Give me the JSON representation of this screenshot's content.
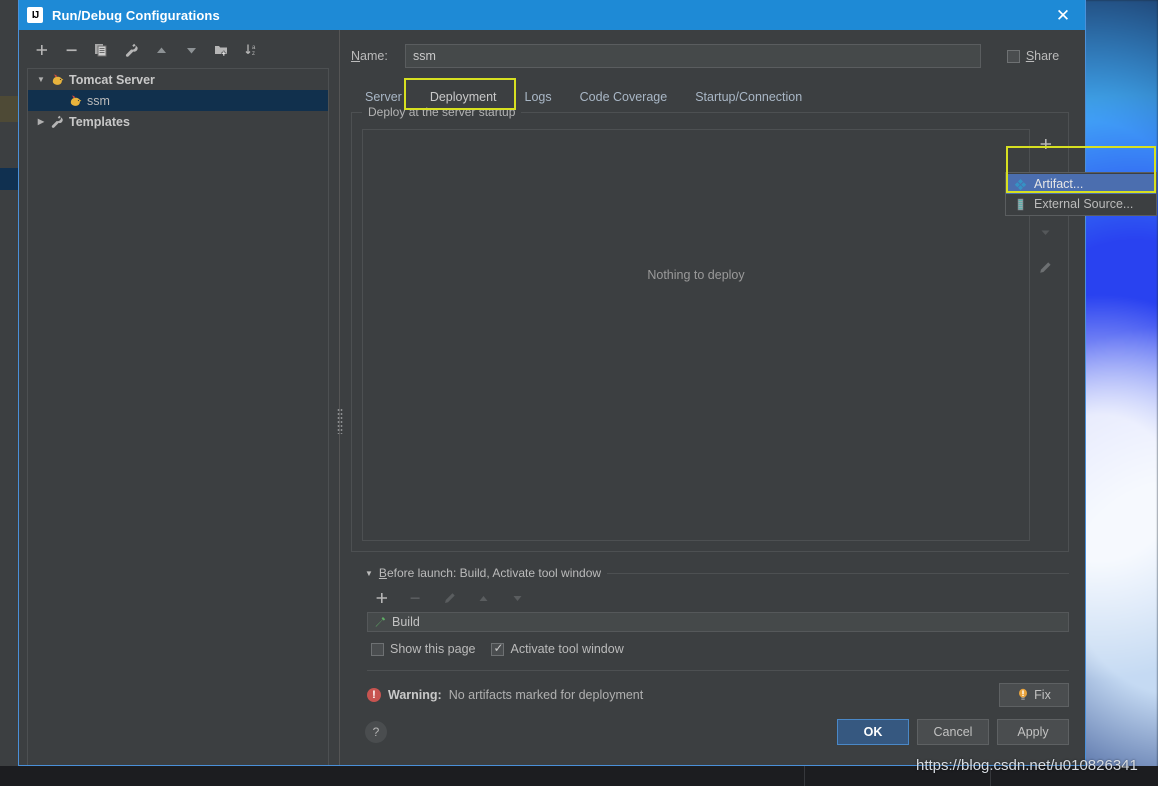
{
  "window": {
    "title": "Run/Debug Configurations",
    "logo_text": "IJ",
    "close_label": "✕"
  },
  "left_toolbar": [
    {
      "name": "add-icon",
      "label": "+"
    },
    {
      "name": "remove-icon",
      "label": "−"
    },
    {
      "name": "copy-icon",
      "label": "Copy"
    },
    {
      "name": "wrench-icon",
      "label": "Edit defaults"
    },
    {
      "name": "move-up-icon",
      "label": "Move Up"
    },
    {
      "name": "move-down-icon",
      "label": "Move Down"
    },
    {
      "name": "new-folder-icon",
      "label": "New Folder"
    },
    {
      "name": "sort-alphabetically-icon",
      "label": "Sort"
    }
  ],
  "tree": {
    "items": [
      {
        "label": "Tomcat Server",
        "icon": "tomcat-icon",
        "expanded": true,
        "selected": false,
        "level": 0,
        "arrow": "▼"
      },
      {
        "label": "ssm",
        "icon": "tomcat-icon",
        "expanded": false,
        "selected": true,
        "level": 1,
        "arrow": ""
      },
      {
        "label": "Templates",
        "icon": "wrench-icon",
        "expanded": false,
        "selected": false,
        "level": 0,
        "arrow": "▶"
      }
    ]
  },
  "name_field": {
    "label": "Name:",
    "label_mnemonic": "N",
    "label_rest": "ame:",
    "value": "ssm",
    "placeholder": ""
  },
  "share": {
    "label": "Share",
    "label_mnemonic": "S",
    "label_rest": "hare",
    "checked": false
  },
  "tabs": [
    {
      "label": "Server",
      "active": false
    },
    {
      "label": "Deployment",
      "active": true
    },
    {
      "label": "Logs",
      "active": false
    },
    {
      "label": "Code Coverage",
      "active": false
    },
    {
      "label": "Startup/Connection",
      "active": false
    }
  ],
  "deployment": {
    "group_title": "Deploy at the server startup",
    "empty_text": "Nothing to deploy",
    "vertical_toolbar": [
      {
        "name": "add-artifact-icon",
        "label": "+"
      },
      {
        "name": "move-down-icon",
        "label": "▼"
      },
      {
        "name": "edit-pencil-icon",
        "label": "Edit"
      }
    ]
  },
  "popup_menu": {
    "items": [
      {
        "label": "Artifact...",
        "icon": "artifact-diamond-icon",
        "selected": true
      },
      {
        "label": "External Source...",
        "icon": "external-source-icon",
        "selected": false
      }
    ]
  },
  "before_launch": {
    "header": "Before launch: Build, Activate tool window",
    "header_mnemonic": "B",
    "header_rest": "efore launch: Build, Activate tool window",
    "collapse_arrow": "▼",
    "toolbar": [
      {
        "name": "add-icon",
        "label": "+",
        "enabled": true
      },
      {
        "name": "remove-icon",
        "label": "−",
        "enabled": false
      },
      {
        "name": "edit-pencil-icon",
        "label": "Edit",
        "enabled": false
      },
      {
        "name": "move-up-icon",
        "label": "▲",
        "enabled": false
      },
      {
        "name": "move-down-icon",
        "label": "▼",
        "enabled": false
      }
    ],
    "task": {
      "label": "Build",
      "icon": "build-hammer-icon"
    },
    "show_this_page": {
      "label": "Show this page",
      "checked": false
    },
    "activate_tool_window": {
      "label": "Activate tool window",
      "checked": true
    }
  },
  "warning": {
    "prefix": "Warning:",
    "message": "No artifacts marked for deployment",
    "fix_label": "Fix",
    "color": "#c75450"
  },
  "footer": {
    "help_label": "?",
    "ok_label": "OK",
    "cancel_label": "Cancel",
    "apply_label": "Apply"
  },
  "watermark": {
    "text": "https://blog.csdn.net/u010826341"
  },
  "colors": {
    "titlebar": "#1e8ad6",
    "dialog_bg": "#3c3f41",
    "accent": "#4a88c7",
    "selection": "#4b6eaf",
    "annotation": "#d7e021",
    "warning": "#c75450"
  }
}
